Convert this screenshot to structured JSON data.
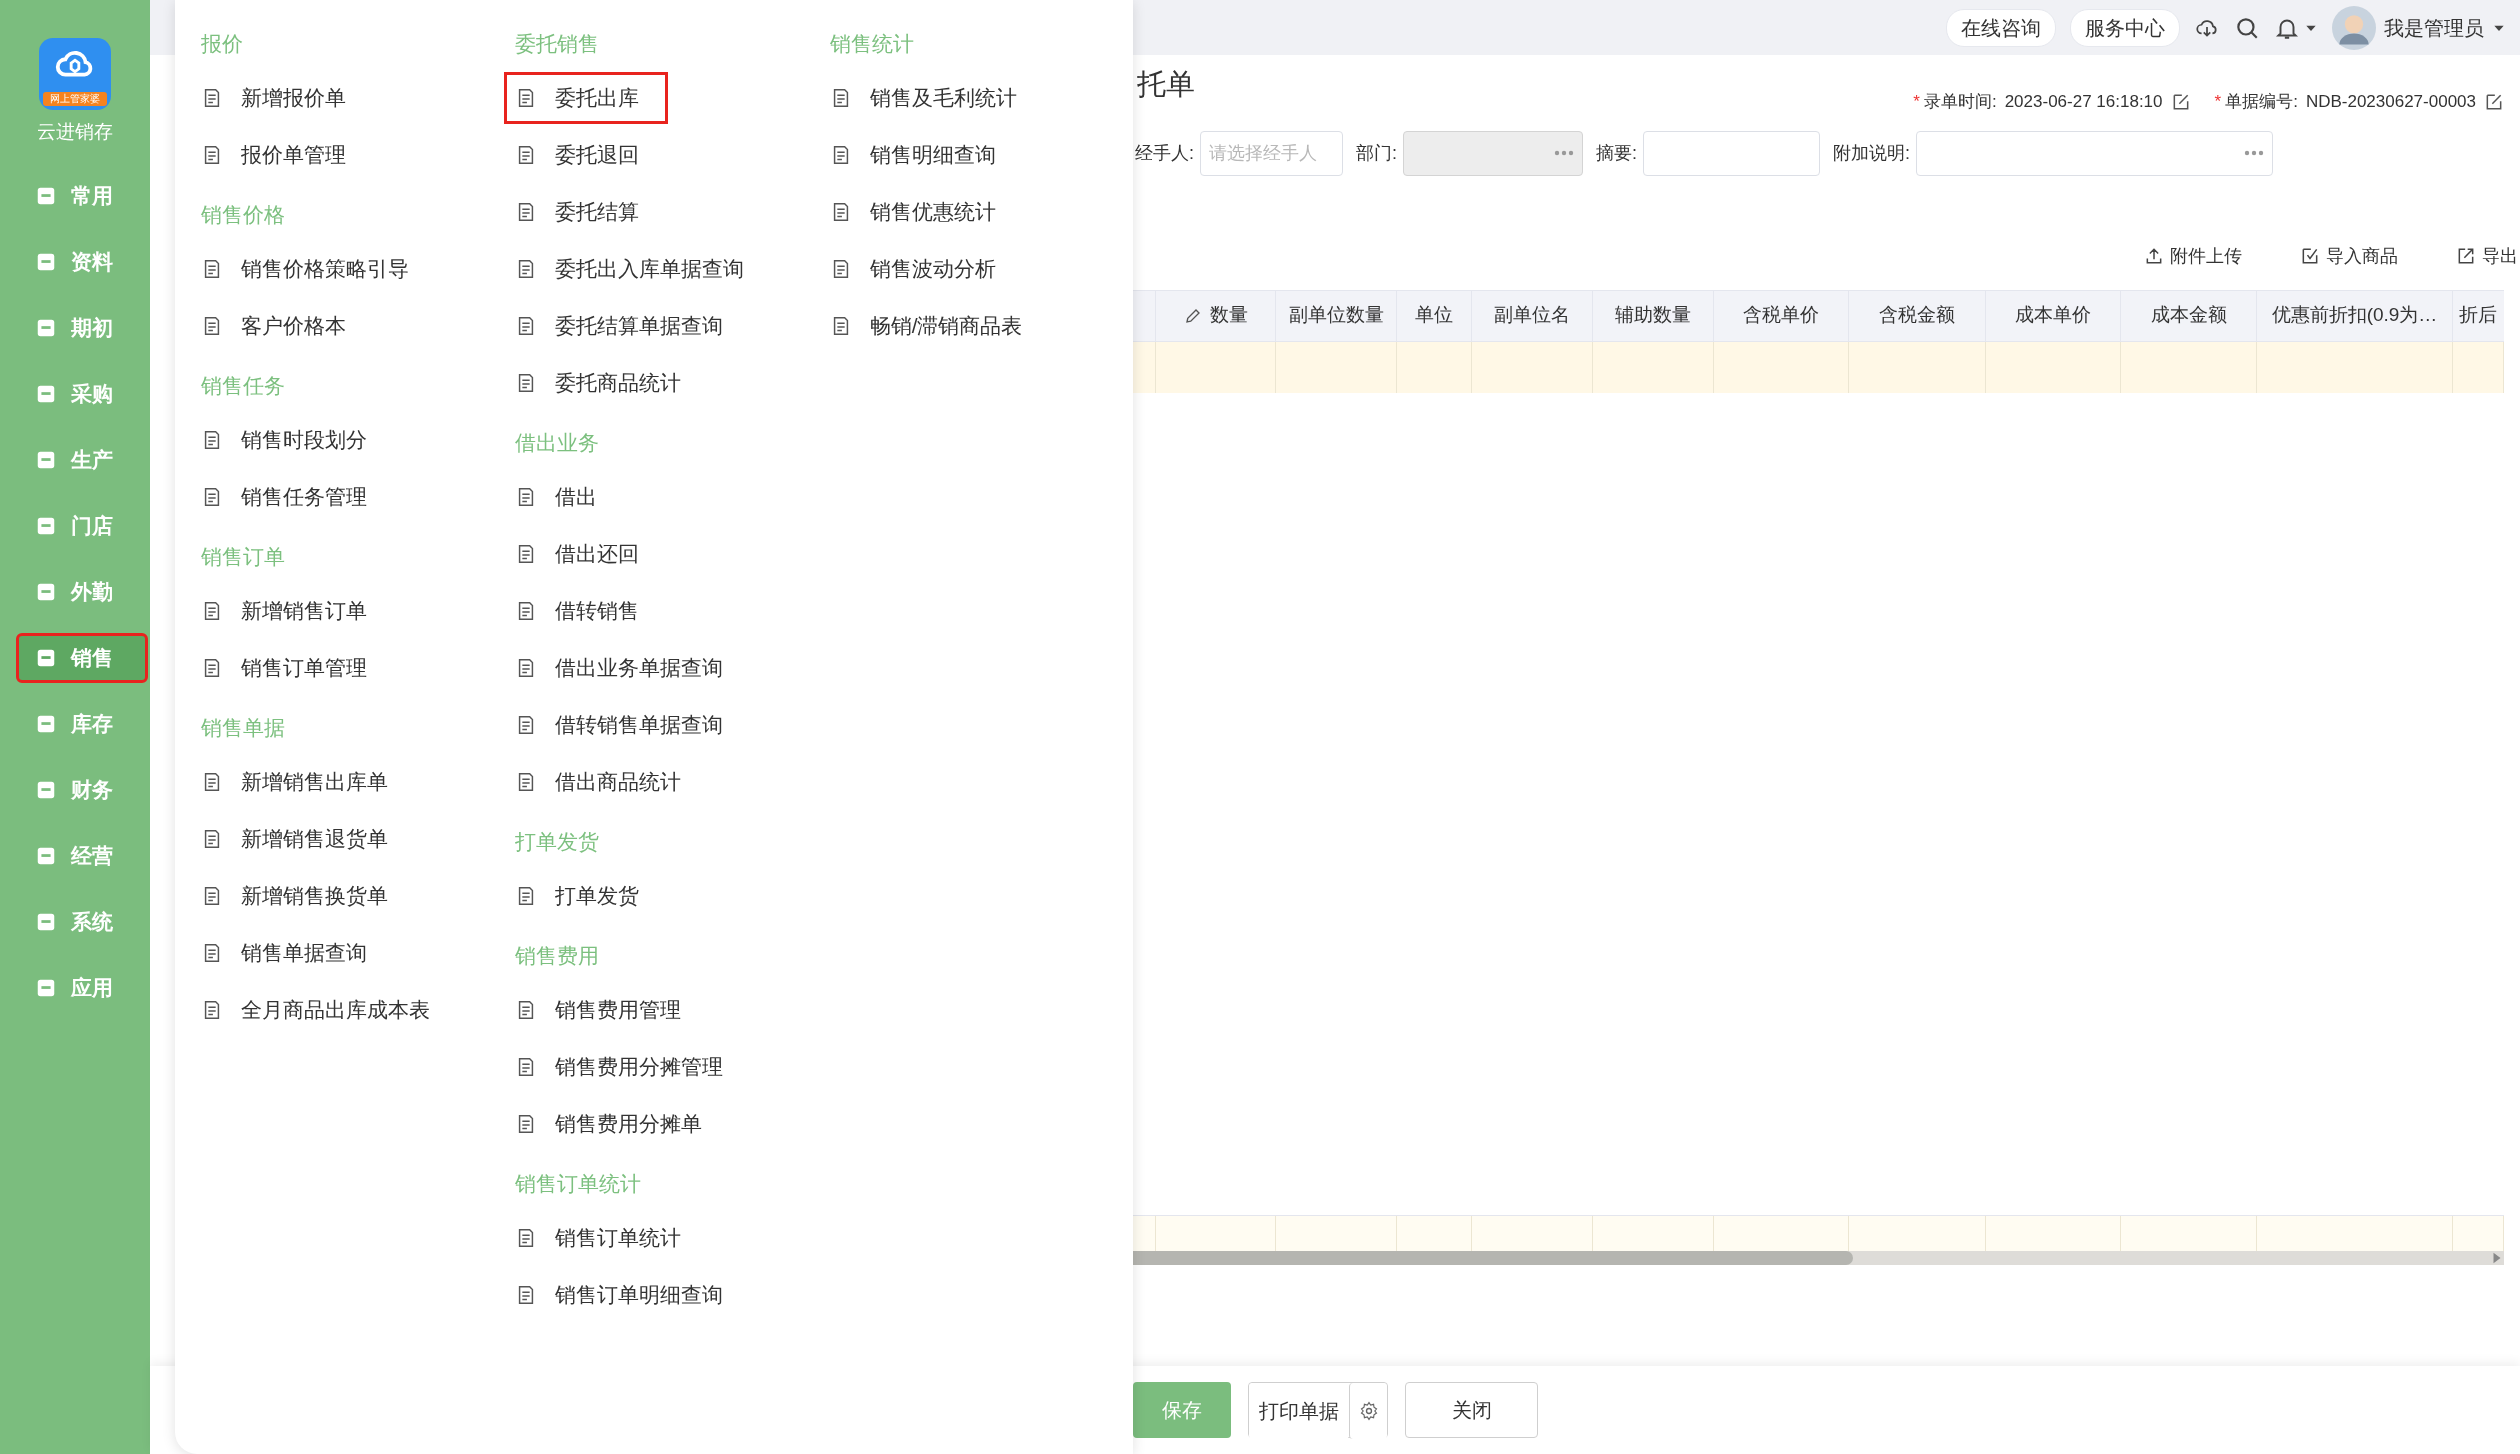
{
  "sidebar": {
    "logo_badge": "网上管家婆",
    "app_name": "云进销存",
    "items": [
      {
        "label": "常用",
        "selected": false
      },
      {
        "label": "资料",
        "selected": false
      },
      {
        "label": "期初",
        "selected": false
      },
      {
        "label": "采购",
        "selected": false
      },
      {
        "label": "生产",
        "selected": false
      },
      {
        "label": "门店",
        "selected": false
      },
      {
        "label": "外勤",
        "selected": false
      },
      {
        "label": "销售",
        "selected": true
      },
      {
        "label": "库存",
        "selected": false
      },
      {
        "label": "财务",
        "selected": false
      },
      {
        "label": "经营",
        "selected": false
      },
      {
        "label": "系统",
        "selected": false
      },
      {
        "label": "应用",
        "selected": false
      }
    ]
  },
  "header": {
    "buttons": [
      "在线咨询",
      "服务中心"
    ],
    "user": "我是管理员"
  },
  "form": {
    "title": "托单",
    "meta": [
      {
        "mark": "*",
        "label": "录单时间:",
        "value": "2023-06-27 16:18:10"
      },
      {
        "mark": "*",
        "label": "单据编号:",
        "value": "NDB-20230627-00003"
      }
    ],
    "fields": [
      {
        "label": "经手人:",
        "kind": "text",
        "placeholder": "请选择经手人",
        "disabled": false
      },
      {
        "label": "部门:",
        "kind": "picker",
        "disabled": true
      },
      {
        "label": "摘要:",
        "kind": "text",
        "disabled": false
      },
      {
        "label": "附加说明:",
        "kind": "picker",
        "disabled": false
      }
    ],
    "toolbar": [
      {
        "label": "附件上传",
        "kind": "upload"
      },
      {
        "label": "导入商品",
        "kind": "import"
      },
      {
        "label": "导出",
        "kind": "export"
      }
    ]
  },
  "table": {
    "columns": [
      {
        "label": "数量",
        "editable": true
      },
      {
        "label": "副单位数量",
        "editable": false
      },
      {
        "label": "单位",
        "editable": false
      },
      {
        "label": "副单位名",
        "editable": false
      },
      {
        "label": "辅助数量",
        "editable": false
      },
      {
        "label": "含税单价",
        "editable": false
      },
      {
        "label": "含税金额",
        "editable": false
      },
      {
        "label": "成本单价",
        "editable": false
      },
      {
        "label": "成本金额",
        "editable": false
      },
      {
        "label": "优惠前折扣(0.9为…",
        "editable": false
      },
      {
        "label": "折后",
        "editable": false
      }
    ]
  },
  "actions": [
    {
      "label": "保存",
      "kind": "primary"
    },
    {
      "label": "打印单据",
      "kind": "split"
    },
    {
      "label": "关闭",
      "kind": "default"
    }
  ],
  "menu": {
    "columns": [
      [
        {
          "title": "报价",
          "items": [
            {
              "label": "新增报价单",
              "highlighted": false
            },
            {
              "label": "报价单管理",
              "highlighted": false
            }
          ]
        },
        {
          "title": "销售价格",
          "items": [
            {
              "label": "销售价格策略引导",
              "highlighted": false
            },
            {
              "label": "客户价格本",
              "highlighted": false
            }
          ]
        },
        {
          "title": "销售任务",
          "items": [
            {
              "label": "销售时段划分",
              "highlighted": false
            },
            {
              "label": "销售任务管理",
              "highlighted": false
            }
          ]
        },
        {
          "title": "销售订单",
          "items": [
            {
              "label": "新增销售订单",
              "highlighted": false
            },
            {
              "label": "销售订单管理",
              "highlighted": false
            }
          ]
        },
        {
          "title": "销售单据",
          "items": [
            {
              "label": "新增销售出库单",
              "highlighted": false
            },
            {
              "label": "新增销售退货单",
              "highlighted": false
            },
            {
              "label": "新增销售换货单",
              "highlighted": false
            },
            {
              "label": "销售单据查询",
              "highlighted": false
            },
            {
              "label": "全月商品出库成本表",
              "highlighted": false
            }
          ]
        }
      ],
      [
        {
          "title": "委托销售",
          "items": [
            {
              "label": "委托出库",
              "highlighted": true
            },
            {
              "label": "委托退回",
              "highlighted": false
            },
            {
              "label": "委托结算",
              "highlighted": false
            },
            {
              "label": "委托出入库单据查询",
              "highlighted": false
            },
            {
              "label": "委托结算单据查询",
              "highlighted": false
            },
            {
              "label": "委托商品统计",
              "highlighted": false
            }
          ]
        },
        {
          "title": "借出业务",
          "items": [
            {
              "label": "借出",
              "highlighted": false
            },
            {
              "label": "借出还回",
              "highlighted": false
            },
            {
              "label": "借转销售",
              "highlighted": false
            },
            {
              "label": "借出业务单据查询",
              "highlighted": false
            },
            {
              "label": "借转销售单据查询",
              "highlighted": false
            },
            {
              "label": "借出商品统计",
              "highlighted": false
            }
          ]
        },
        {
          "title": "打单发货",
          "items": [
            {
              "label": "打单发货",
              "highlighted": false
            }
          ]
        },
        {
          "title": "销售费用",
          "items": [
            {
              "label": "销售费用管理",
              "highlighted": false
            },
            {
              "label": "销售费用分摊管理",
              "highlighted": false
            },
            {
              "label": "销售费用分摊单",
              "highlighted": false
            }
          ]
        },
        {
          "title": "销售订单统计",
          "items": [
            {
              "label": "销售订单统计",
              "highlighted": false
            },
            {
              "label": "销售订单明细查询",
              "highlighted": false
            }
          ]
        }
      ],
      [
        {
          "title": "销售统计",
          "items": [
            {
              "label": "销售及毛利统计",
              "highlighted": false
            },
            {
              "label": "销售明细查询",
              "highlighted": false
            },
            {
              "label": "销售优惠统计",
              "highlighted": false
            },
            {
              "label": "销售波动分析",
              "highlighted": false
            },
            {
              "label": "畅销/滞销商品表",
              "highlighted": false
            }
          ]
        }
      ]
    ]
  }
}
